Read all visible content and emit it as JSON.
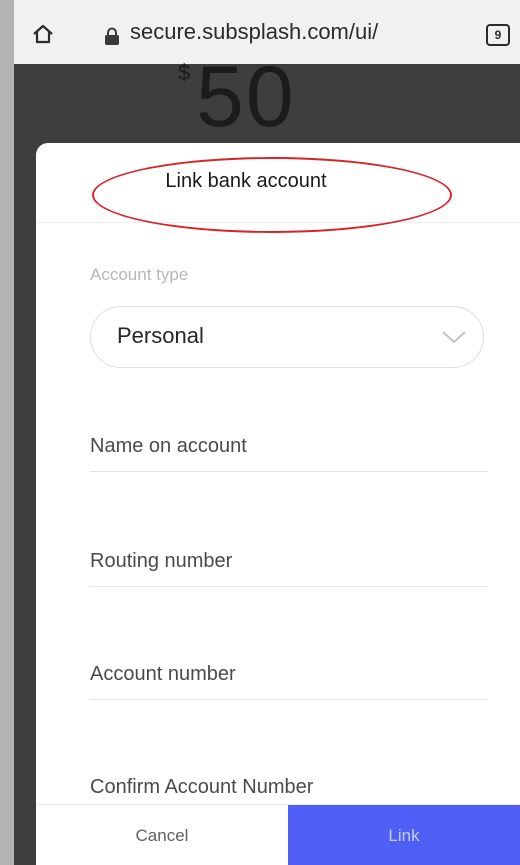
{
  "browser": {
    "url": "secure.subsplash.com/ui/",
    "tab_count": "9"
  },
  "background_page": {
    "currency_symbol": "$",
    "amount": "50"
  },
  "modal": {
    "title": "Link bank account",
    "account_type_label": "Account type",
    "account_type_value": "Personal",
    "name_on_account_placeholder": "Name on account",
    "routing_number_placeholder": "Routing number",
    "account_number_placeholder": "Account number",
    "confirm_account_number_placeholder": "Confirm Account Number",
    "cancel_label": "Cancel",
    "link_label": "Link"
  },
  "colors": {
    "primary_button": "#4f5ef5",
    "annotation": "#d8232a"
  }
}
